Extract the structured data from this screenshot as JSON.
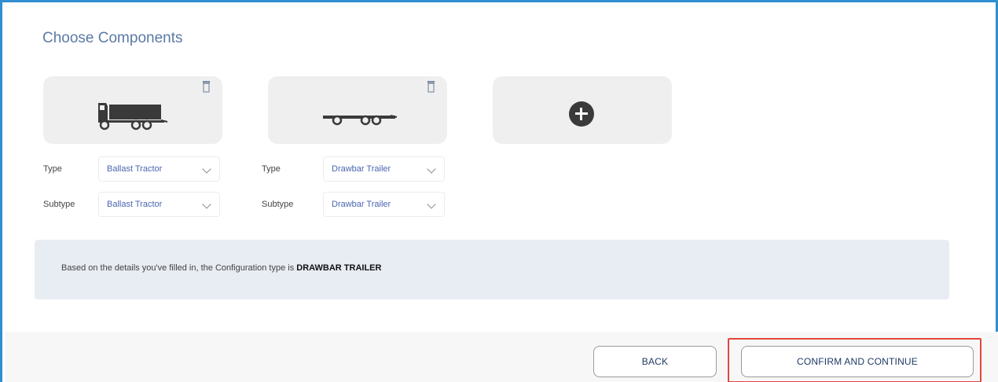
{
  "page": {
    "title": "Choose Components"
  },
  "components": [
    {
      "icon": "ballast-tractor-icon",
      "type_label": "Type",
      "type_value": "Ballast Tractor",
      "subtype_label": "Subtype",
      "subtype_value": "Ballast Tractor"
    },
    {
      "icon": "drawbar-trailer-icon",
      "type_label": "Type",
      "type_value": "Drawbar Trailer",
      "subtype_label": "Subtype",
      "subtype_value": "Drawbar Trailer"
    }
  ],
  "add_component": {
    "icon": "plus-circle-icon"
  },
  "info": {
    "prefix": "Based on the details you've filled in, the Configuration type is ",
    "config_type": "DRAWBAR TRAILER"
  },
  "buttons": {
    "back": "BACK",
    "confirm": "CONFIRM AND CONTINUE"
  },
  "colors": {
    "frame": "#2f8fcf",
    "highlight": "#e0473e",
    "select_text": "#4a66b0",
    "title": "#5b7aa5"
  }
}
